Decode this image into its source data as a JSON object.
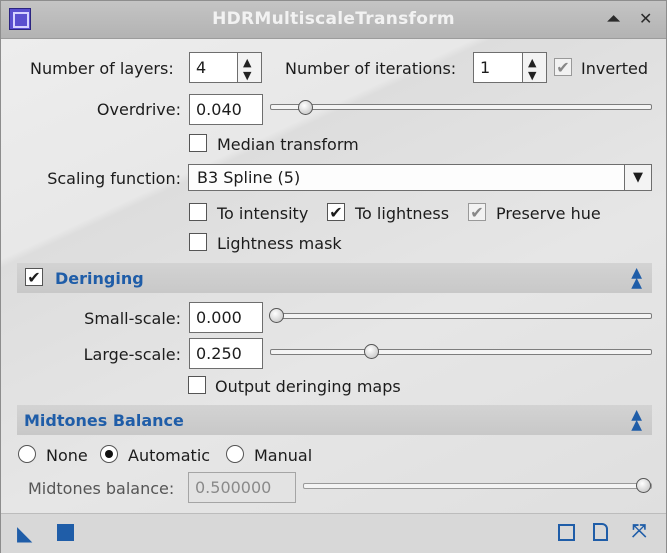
{
  "window": {
    "title": "HDRMultiscaleTransform",
    "titlebar_buttons": {
      "shade": "⏶",
      "close": "✕"
    }
  },
  "main": {
    "layers_label": "Number of layers:",
    "layers_value": "4",
    "iterations_label": "Number of iterations:",
    "iterations_value": "1",
    "inverted_label": "Inverted",
    "inverted_checked": true,
    "overdrive_label": "Overdrive:",
    "overdrive_value": "0.040",
    "overdrive_slider_fraction": 0.04,
    "median_label": "Median transform",
    "median_checked": false,
    "scaling_label": "Scaling function:",
    "scaling_value": "B3 Spline (5)",
    "to_intensity_label": "To intensity",
    "to_intensity_checked": false,
    "to_lightness_label": "To lightness",
    "to_lightness_checked": true,
    "preserve_hue_label": "Preserve hue",
    "preserve_hue_checked": true,
    "lightness_mask_label": "Lightness mask",
    "lightness_mask_checked": false
  },
  "deringing": {
    "title": "Deringing",
    "enabled": true,
    "small_label": "Small-scale:",
    "small_value": "0.000",
    "small_fraction": 0.0,
    "large_label": "Large-scale:",
    "large_value": "0.250",
    "large_fraction": 0.25,
    "output_maps_label": "Output deringing maps",
    "output_maps_checked": false
  },
  "midtones": {
    "title": "Midtones Balance",
    "none_label": "None",
    "automatic_label": "Automatic",
    "manual_label": "Manual",
    "selected": "Automatic",
    "balance_label": "Midtones balance:",
    "balance_value": "0.500000",
    "balance_fraction": 1.0
  },
  "colors": {
    "accent": "#1f5da8",
    "titlebar": "#b8b8b8",
    "app_icon": "#5a4fcf"
  }
}
